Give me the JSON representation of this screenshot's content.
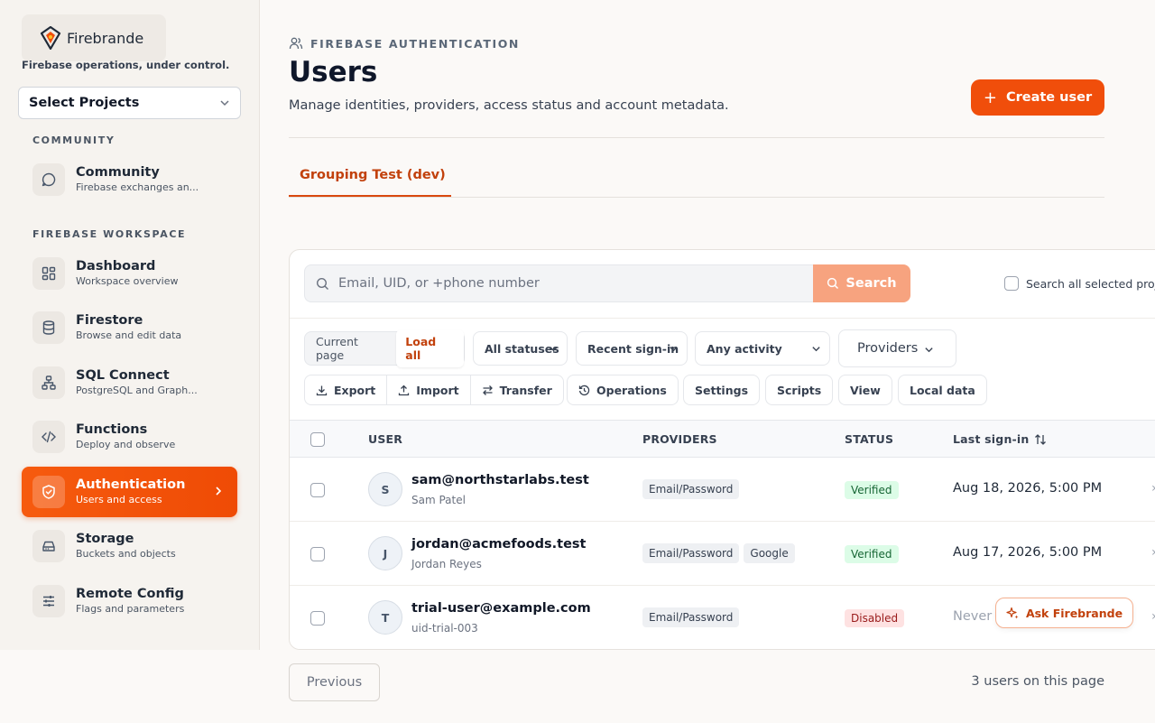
{
  "brand": {
    "name": "Firebrande",
    "tagline": "Firebase operations, under control."
  },
  "project_select": {
    "label": "Select Projects"
  },
  "sidebar": {
    "sections": [
      {
        "label": "COMMUNITY"
      },
      {
        "label": "FIREBASE WORKSPACE"
      }
    ],
    "items": [
      {
        "title": "Community",
        "sub": "Firebase exchanges an...",
        "icon": "chat-bubble-icon"
      },
      {
        "title": "Dashboard",
        "sub": "Workspace overview",
        "icon": "grid-icon"
      },
      {
        "title": "Firestore",
        "sub": "Browse and edit data",
        "icon": "database-icon"
      },
      {
        "title": "SQL Connect",
        "sub": "PostgreSQL and Graph...",
        "icon": "network-icon"
      },
      {
        "title": "Functions",
        "sub": "Deploy and observe",
        "icon": "code-icon"
      },
      {
        "title": "Authentication",
        "sub": "Users and access",
        "icon": "shield-check-icon",
        "active": true
      },
      {
        "title": "Storage",
        "sub": "Buckets and objects",
        "icon": "storage-drive-icon"
      },
      {
        "title": "Remote Config",
        "sub": "Flags and parameters",
        "icon": "sliders-icon"
      }
    ]
  },
  "header": {
    "eyebrow": "FIREBASE AUTHENTICATION",
    "title": "Users",
    "description": "Manage identities, providers, access status and account metadata.",
    "create_button": "Create user"
  },
  "tabs": [
    {
      "label": "Grouping Test (dev)",
      "active": true
    }
  ],
  "search": {
    "placeholder": "Email, UID, or +phone number",
    "button": "Search",
    "search_all_label": "Search all selected projects"
  },
  "filters": {
    "scope_label": "Current page",
    "load_all": "Load all",
    "status": "All statuses",
    "sort": "Recent sign-in",
    "activity": "Any activity",
    "providers": "Providers"
  },
  "toolbar": {
    "export": "Export",
    "import": "Import",
    "transfer": "Transfer",
    "operations": "Operations",
    "settings": "Settings",
    "scripts": "Scripts",
    "view": "View",
    "local_data": "Local data"
  },
  "table": {
    "columns": {
      "user": "USER",
      "providers": "PROVIDERS",
      "status": "STATUS",
      "last_sign_in": "Last sign-in"
    },
    "rows": [
      {
        "initial": "S",
        "email": "sam@northstarlabs.test",
        "sub": "Sam Patel",
        "providers": [
          "Email/Password"
        ],
        "status": "Verified",
        "last_sign_in": "Aug 18, 2026, 5:00 PM"
      },
      {
        "initial": "J",
        "email": "jordan@acmefoods.test",
        "sub": "Jordan Reyes",
        "providers": [
          "Email/Password",
          "Google"
        ],
        "status": "Verified",
        "last_sign_in": "Aug 17, 2026, 5:00 PM"
      },
      {
        "initial": "T",
        "email": "trial-user@example.com",
        "sub": "uid-trial-003",
        "providers": [
          "Email/Password"
        ],
        "status": "Disabled",
        "last_sign_in": "Never"
      }
    ]
  },
  "assistant": {
    "label": "Ask Firebrande"
  },
  "pagination": {
    "previous": "Previous",
    "count": "3 users on this page"
  },
  "colors": {
    "accent": "#f04e0b",
    "accent_soft": "#f7a37f",
    "verified": "#dcfce7",
    "disabled": "#fee2e2"
  }
}
